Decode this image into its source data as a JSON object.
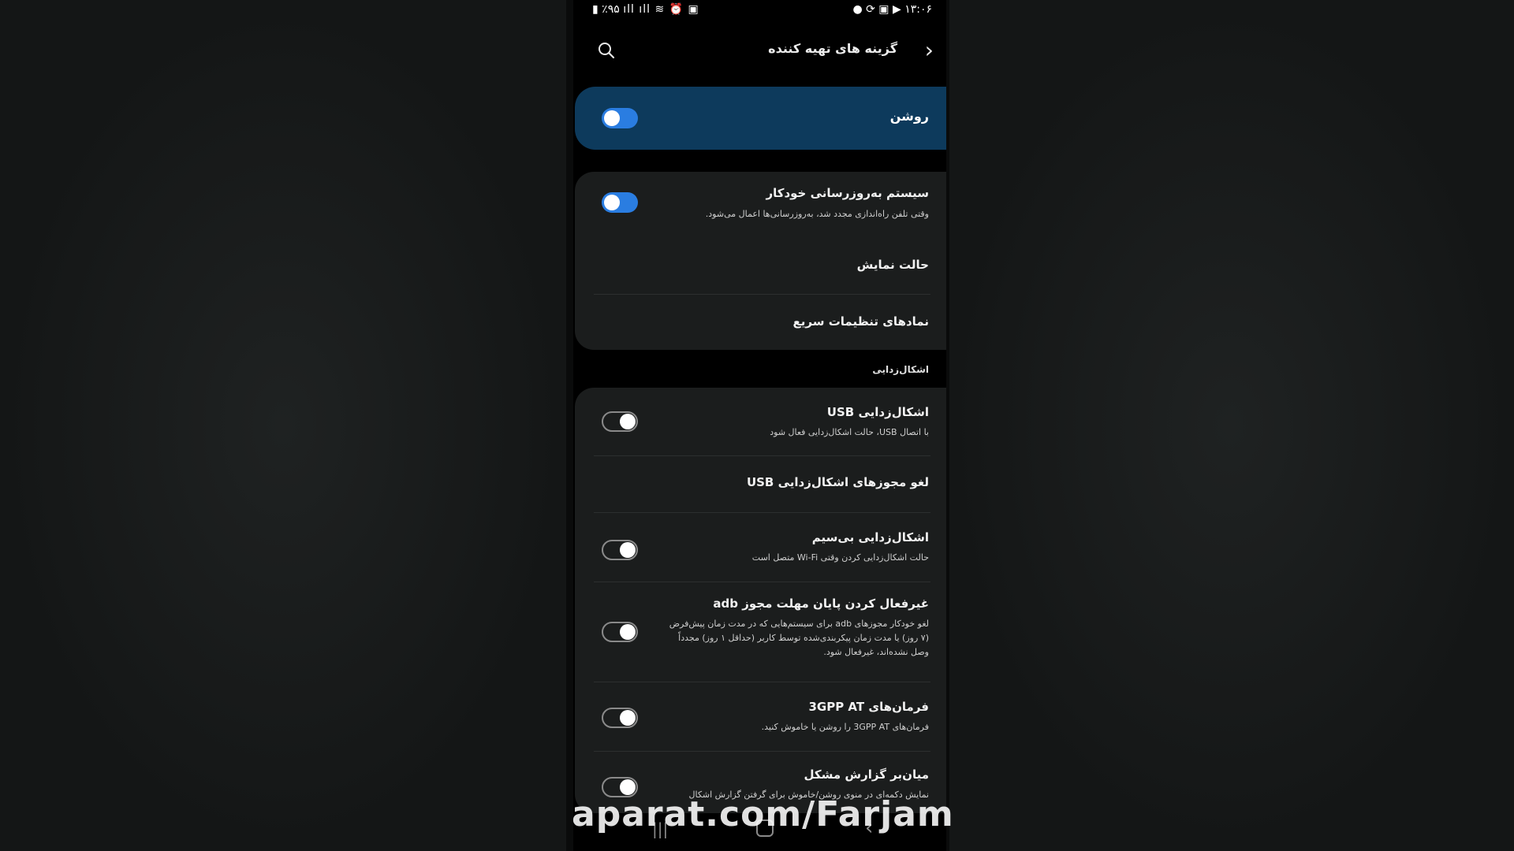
{
  "status_bar": {
    "time": "۱۳:۰۶",
    "battery": "٪۹۵"
  },
  "header": {
    "title": "گزینه های تهیه کننده",
    "back_icon": "chevron-right-icon",
    "search_icon": "search-icon"
  },
  "master_toggle": {
    "label": "روشن",
    "on": true
  },
  "general_items": [
    {
      "title": "سیستم به‌روزرسانی خودکار",
      "subtitle": "وقتی تلفن راه‌اندازی مجدد شد، به‌روزرسانی‌ها اعمال می‌شود.",
      "toggle": "on"
    },
    {
      "title": "حالت نمایش"
    },
    {
      "title": "نمادهای تنظیمات سریع"
    }
  ],
  "debug_section": {
    "header": "اشکال‌زدایی",
    "items": [
      {
        "title": "اشکال‌زدایی USB",
        "subtitle": "با اتصال USB، حالت اشکال‌زدایی فعال شود",
        "toggle": "off"
      },
      {
        "title": "لغو مجوزهای اشکال‌زدایی USB"
      },
      {
        "title": "اشکال‌زدایی بی‌سیم",
        "subtitle": "حالت اشکال‌زدایی کردن وقتی Wi-Fi متصل است",
        "toggle": "off"
      },
      {
        "title": "غیرفعال کردن پایان مهلت مجوز adb",
        "subtitle": "لغو خودکار مجوزهای adb برای سیستم‌هایی که در مدت زمان پیش‌فرض (۷ روز) یا مدت زمان پیکربندی‌شده توسط کاربر (حداقل ۱ روز) مجدداً وصل نشده‌اند، غیرفعال شود.",
        "toggle": "off"
      },
      {
        "title": "فرمان‌های 3GPP AT",
        "subtitle": "فرمان‌های 3GPP AT را روشن یا خاموش کنید.",
        "toggle": "off"
      },
      {
        "title": "میان‌بر گزارش مشکل",
        "subtitle": "نمایش دکمه‌ای در منوی روشن/خاموش برای گرفتن گزارش اشکال",
        "toggle": "off"
      }
    ]
  },
  "watermark": "aparat.com/Farjam",
  "colors": {
    "accent": "#2a7de1",
    "master_bg": "#0d3a5c",
    "card_bg": "#1b1d1d"
  }
}
